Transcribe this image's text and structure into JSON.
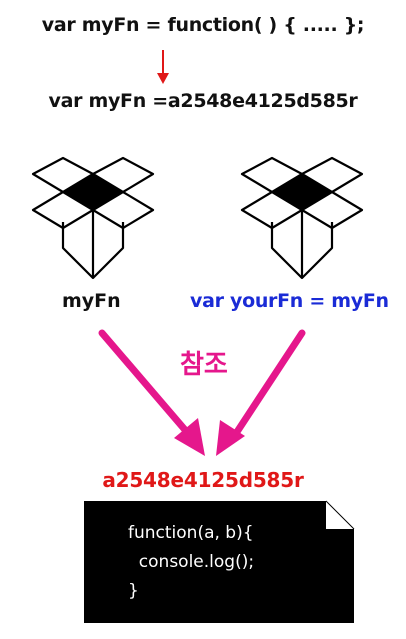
{
  "top": {
    "declaration": "var myFn = function( ) { ..... };",
    "reference_line": "var myFn =a2548e4125d585r"
  },
  "boxes": {
    "left_label": "myFn",
    "right_label": "var yourFn = myFn"
  },
  "reference_label": "참조",
  "address": "a2548e4125d585r",
  "code": {
    "line1": "function(a, b){",
    "line2": "  console.log();",
    "line3": "}"
  },
  "colors": {
    "arrow_red": "#e01818",
    "arrow_pink": "#e5178c",
    "label_blue": "#1a2bd6",
    "address_red": "#e01818",
    "code_bg": "#000000"
  }
}
